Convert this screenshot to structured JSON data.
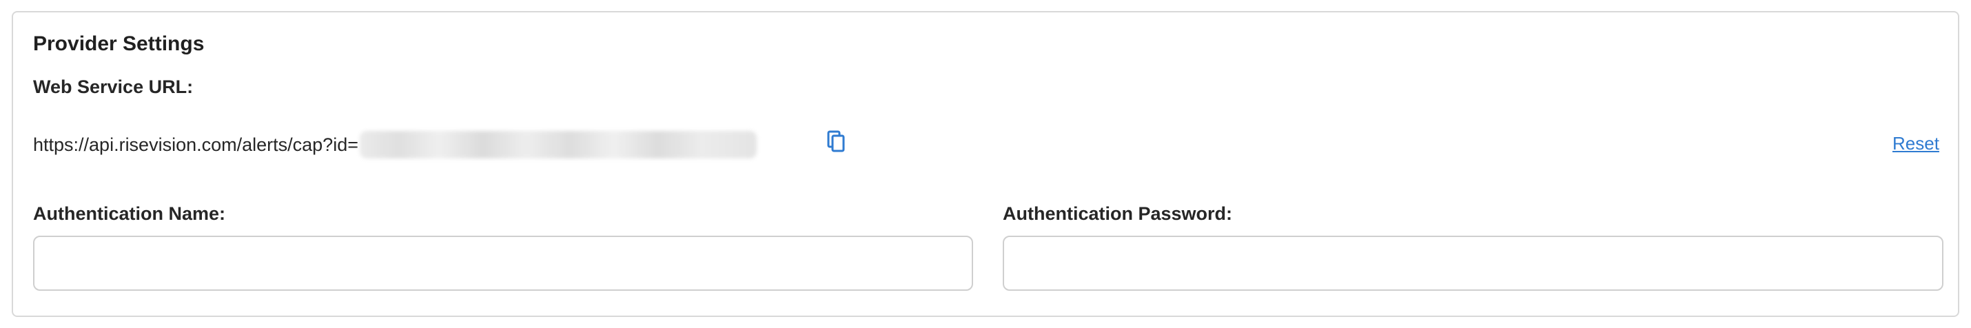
{
  "section": {
    "title": "Provider Settings"
  },
  "web_service": {
    "label": "Web Service URL:",
    "url_prefix": "https://api.risevision.com/alerts/cap?id=",
    "url_id_redacted": true,
    "copy_icon": "copy-icon",
    "reset_label": "Reset"
  },
  "auth_name": {
    "label": "Authentication Name:",
    "value": "",
    "placeholder": ""
  },
  "auth_password": {
    "label": "Authentication Password:",
    "value": "",
    "placeholder": ""
  },
  "colors": {
    "link": "#2f7bd1",
    "border": "#d9d9d9",
    "text": "#262626"
  }
}
